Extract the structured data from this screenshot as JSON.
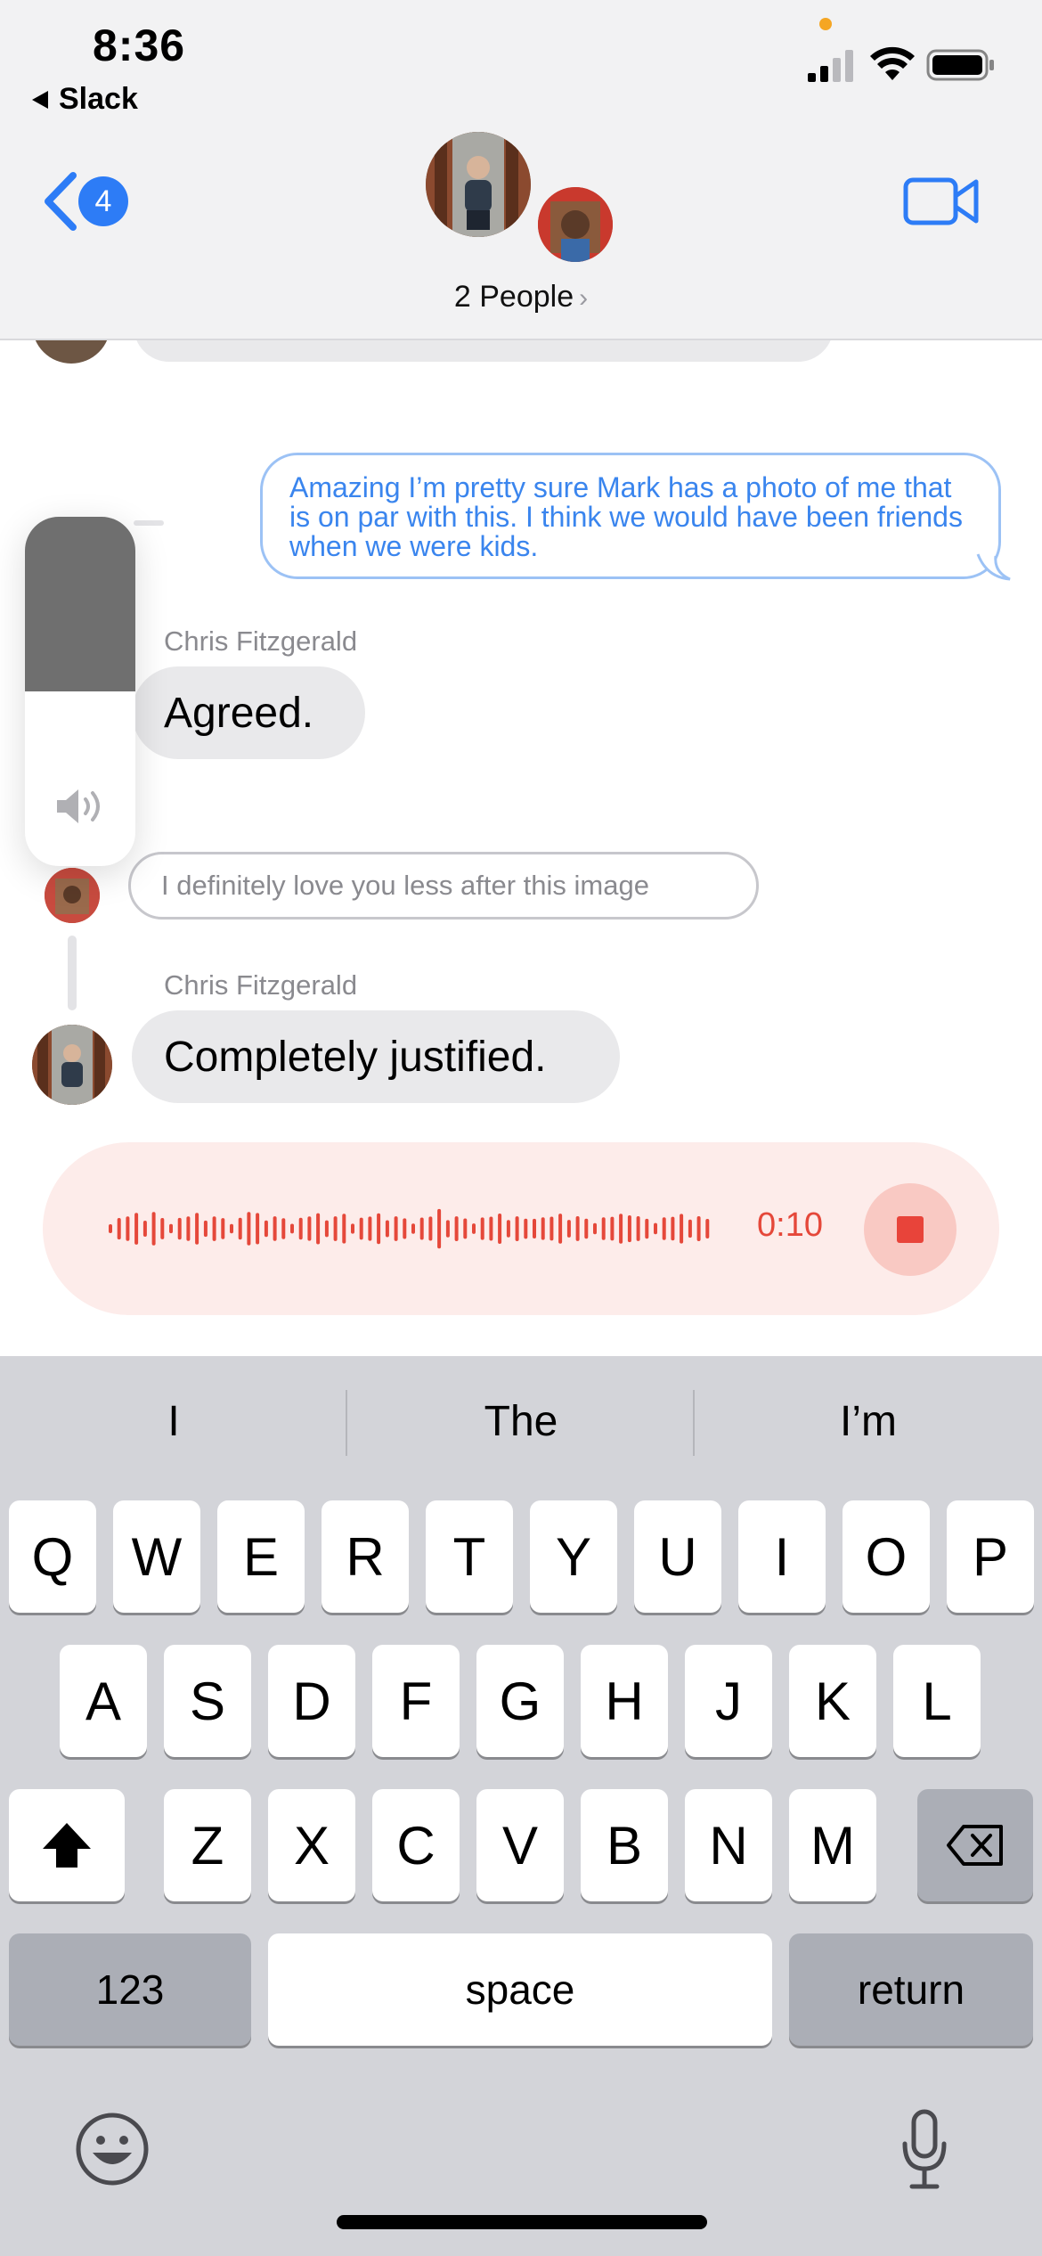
{
  "status_bar": {
    "time": "8:36",
    "back_app": "Slack",
    "icons": [
      "signal-icon",
      "wifi-icon",
      "battery-icon"
    ]
  },
  "header": {
    "unread_count": "4",
    "people_label": "2 People",
    "icons": [
      "chevron-left-icon",
      "video-camera-icon"
    ]
  },
  "messages": {
    "sent_text": "Amazing I’m pretty sure Mark has a photo of me that is on par with this. I think we would have been friends when we were kids.",
    "agreed_sender": "Chris Fitzgerald",
    "agreed_text": "Agreed.",
    "reply_text": "I definitely love you less after this image",
    "justified_sender": "Chris Fitzgerald",
    "justified_text": "Completely justified."
  },
  "volume_hud": {
    "level_fraction": 0.5
  },
  "recorder": {
    "elapsed": "0:10",
    "accent_color": "#e5483a"
  },
  "keyboard": {
    "suggestions": [
      "I",
      "The",
      "I’m"
    ],
    "row1": [
      "Q",
      "W",
      "E",
      "R",
      "T",
      "Y",
      "U",
      "I",
      "O",
      "P"
    ],
    "row2": [
      "A",
      "S",
      "D",
      "F",
      "G",
      "H",
      "J",
      "K",
      "L"
    ],
    "row3": [
      "Z",
      "X",
      "C",
      "V",
      "B",
      "N",
      "M"
    ],
    "numbers_label": "123",
    "space_label": "space",
    "return_label": "return"
  },
  "colors": {
    "accent_blue": "#2d7cf6",
    "bubble_gray": "#e9e9eb",
    "keyboard_bg": "#d3d4d9"
  }
}
